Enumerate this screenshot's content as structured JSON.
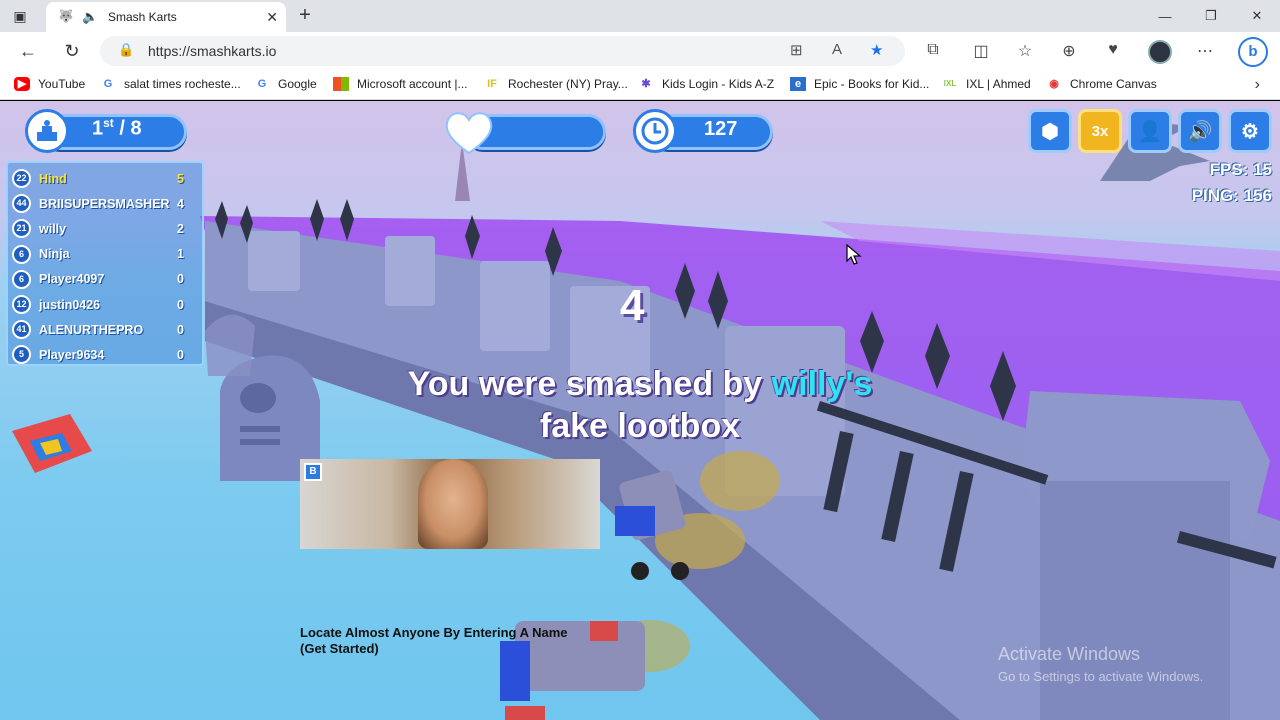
{
  "browser": {
    "tab": {
      "title": "Smash Karts",
      "favicon": "smashkarts-icon",
      "audio_icon": "speaker-icon"
    },
    "window_controls": [
      "minimize",
      "restore",
      "close"
    ],
    "url": "https://smashkarts.io",
    "bookmarks": [
      {
        "label": "YouTube",
        "icon": "youtube-icon",
        "color": "#ff0000"
      },
      {
        "label": "salat times rocheste...",
        "icon": "google-icon",
        "color": "#4285f4"
      },
      {
        "label": "Google",
        "icon": "google-icon",
        "color": "#4285f4"
      },
      {
        "label": "Microsoft account |...",
        "icon": "microsoft-icon",
        "color": "#f25022"
      },
      {
        "label": "Rochester (NY) Pray...",
        "icon": "if-icon",
        "color": "#d6c22a"
      },
      {
        "label": "Kids Login - Kids A-Z",
        "icon": "kidsaz-icon",
        "color": "#6a4bd3"
      },
      {
        "label": "Epic - Books for Kid...",
        "icon": "epic-icon",
        "color": "#2a6fc9"
      },
      {
        "label": "IXL | Ahmed",
        "icon": "ixl-icon",
        "color": "#8bc53f"
      },
      {
        "label": "Chrome Canvas",
        "icon": "chrome-canvas-icon",
        "color": "#e53935"
      }
    ]
  },
  "hud": {
    "rank": {
      "place": "1",
      "suffix": "st",
      "total": "/ 8"
    },
    "health_fraction": 1.0,
    "timer": "127",
    "fps": "FPS: 15",
    "ping": "PING: 156",
    "multiplier": "3x",
    "accent": "#2c7de6"
  },
  "leaderboard": [
    {
      "level": "22",
      "name": "Hind",
      "score": "5"
    },
    {
      "level": "44",
      "name": "BRIISUPERSMASHER",
      "score": "4"
    },
    {
      "level": "21",
      "name": "willy",
      "score": "2"
    },
    {
      "level": "6",
      "name": "Ninja",
      "score": "1"
    },
    {
      "level": "6",
      "name": "Player4097",
      "score": "0"
    },
    {
      "level": "12",
      "name": "justin0426",
      "score": "0"
    },
    {
      "level": "41",
      "name": "ALENURTHEPRO",
      "score": "0"
    },
    {
      "level": "5",
      "name": "Player9634",
      "score": "0"
    }
  ],
  "message": {
    "countdown": "4",
    "prefix": "You were smashed by ",
    "killer": "willy's",
    "weapon": "fake lootbox"
  },
  "ad": {
    "badge": "B",
    "caption_line1": "Locate Almost Anyone By Entering A Name",
    "caption_line2": "(Get Started)"
  },
  "watermark": {
    "line1": "Activate Windows",
    "line2": "Go to Settings to activate Windows."
  }
}
